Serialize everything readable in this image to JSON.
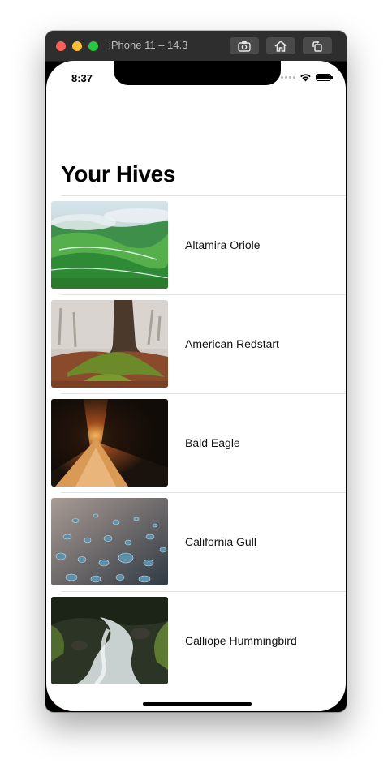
{
  "simulator": {
    "title": "iPhone 11 – 14.3",
    "buttons": [
      "screenshot-icon",
      "home-icon",
      "rotate-icon"
    ]
  },
  "status_bar": {
    "time": "8:37",
    "icons": [
      "cellular-signal-icon",
      "wifi-icon",
      "battery-icon"
    ]
  },
  "nav": {
    "title": "Your Hives"
  },
  "list": {
    "items": [
      {
        "label": "Altamira Oriole",
        "image": "green-mountain-valley-photo"
      },
      {
        "label": "American Redstart",
        "image": "mossy-tree-roots-forest-photo"
      },
      {
        "label": "Bald Eagle",
        "image": "dark-forest-path-sunset-photo"
      },
      {
        "label": "California Gull",
        "image": "water-droplets-photo"
      },
      {
        "label": "Calliope Hummingbird",
        "image": "mossy-stream-waterfall-photo"
      },
      {
        "label": "",
        "image": "autumn-forest-photo"
      }
    ]
  }
}
